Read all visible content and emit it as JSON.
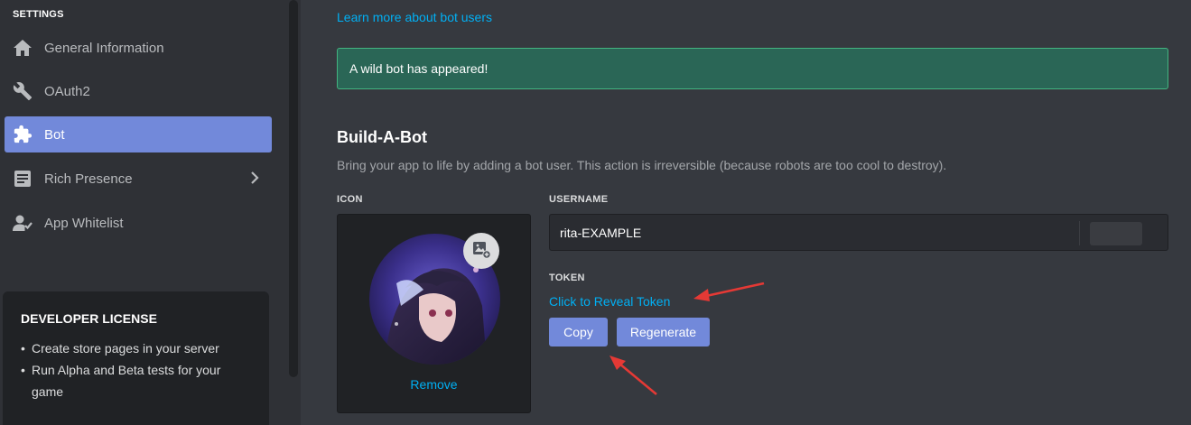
{
  "sidebar": {
    "heading": "SETTINGS",
    "items": [
      {
        "label": "General Information",
        "icon": "home-icon"
      },
      {
        "label": "OAuth2",
        "icon": "wrench-icon"
      },
      {
        "label": "Bot",
        "icon": "puzzle-icon",
        "active": true
      },
      {
        "label": "Rich Presence",
        "icon": "document-icon"
      },
      {
        "label": "App Whitelist",
        "icon": "user-whitelist-icon"
      }
    ],
    "license": {
      "title": "DEVELOPER LICENSE",
      "bullets": [
        "Create store pages in your server",
        "Run Alpha and Beta tests for your game"
      ]
    }
  },
  "main": {
    "learn_more_link": "Learn more about bot users",
    "banner": "A wild bot has appeared!",
    "section_title": "Build-A-Bot",
    "section_desc": "Bring your app to life by adding a bot user. This action is irreversible (because robots are too cool to destroy).",
    "icon_label": "ICON",
    "remove_label": "Remove",
    "username_label": "USERNAME",
    "username_value": "rita-EXAMPLE",
    "token_label": "TOKEN",
    "reveal_token": "Click to Reveal Token",
    "copy_label": "Copy",
    "regenerate_label": "Regenerate"
  },
  "colors": {
    "accent": "#7289da",
    "link": "#00b0f4",
    "banner_bg": "#2a6656",
    "banner_border": "#43b581",
    "annotation_arrow": "#e53935"
  }
}
